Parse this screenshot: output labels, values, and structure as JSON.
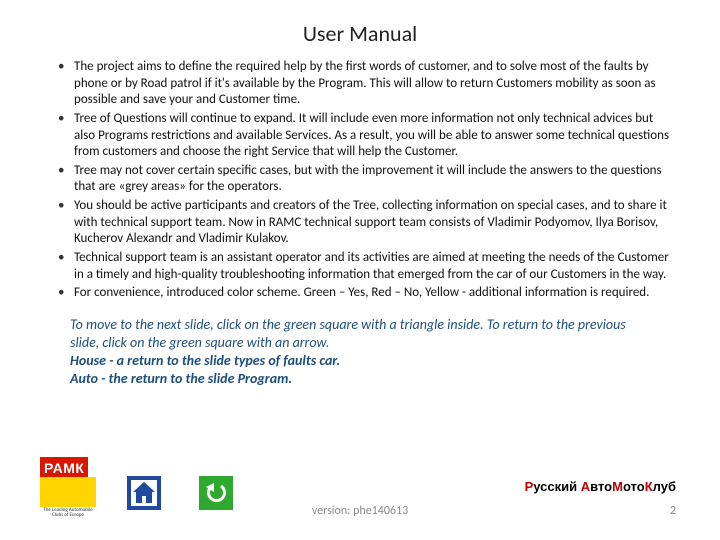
{
  "title": "User Manual",
  "bullets": [
    "The project aims to define the required help by the first words of customer, and to solve most of the faults by phone or by Road patrol if it's available by the Program. This will allow to return Customers mobility as soon as possible and save your and Customer time.",
    "Tree of Questions will continue to expand. It will include even more information not only technical advices but also Programs restrictions and available Services. As a result, you will be able to answer some technical questions from customers and choose the right Service that will help the Customer.",
    "Tree may not cover certain specific cases, but with the improvement it will include the answers to the questions that are «grey areas» for the operators.",
    "You should be active participants and creators of the Tree, collecting information on special cases, and to share it with technical support team. Now in RAMC technical support team consists of  Vladimir Podyomov, Ilya Borisov, Kucherov Alexandr and Vladimir Kulakov.",
    "Technical support team is an assistant operator and its activities are aimed at meeting the needs of the Customer in a timely and high-quality troubleshooting information that emerged from the car of our Customers in the way.",
    "For convenience, introduced color scheme. Green – Yes, Red – No, Yellow - additional information is required."
  ],
  "instructions": {
    "line1": "To move to the next slide, click on the green square with a triangle inside. To return to the previous slide, click on the green square with an arrow.",
    "line2": "House - a return to the slide types of faults car.",
    "line3": "Auto - the return to the slide Program."
  },
  "logo": {
    "text": "РАМК",
    "sub": "The Leading Automobile Clubs of Europe"
  },
  "brand": {
    "r1": "Р",
    "b1": "усский ",
    "r2": "А",
    "b2": "вто",
    "r3": "М",
    "b3": "ото",
    "r4": "К",
    "b4": "луб"
  },
  "version": "version: phe140613",
  "page": "2"
}
